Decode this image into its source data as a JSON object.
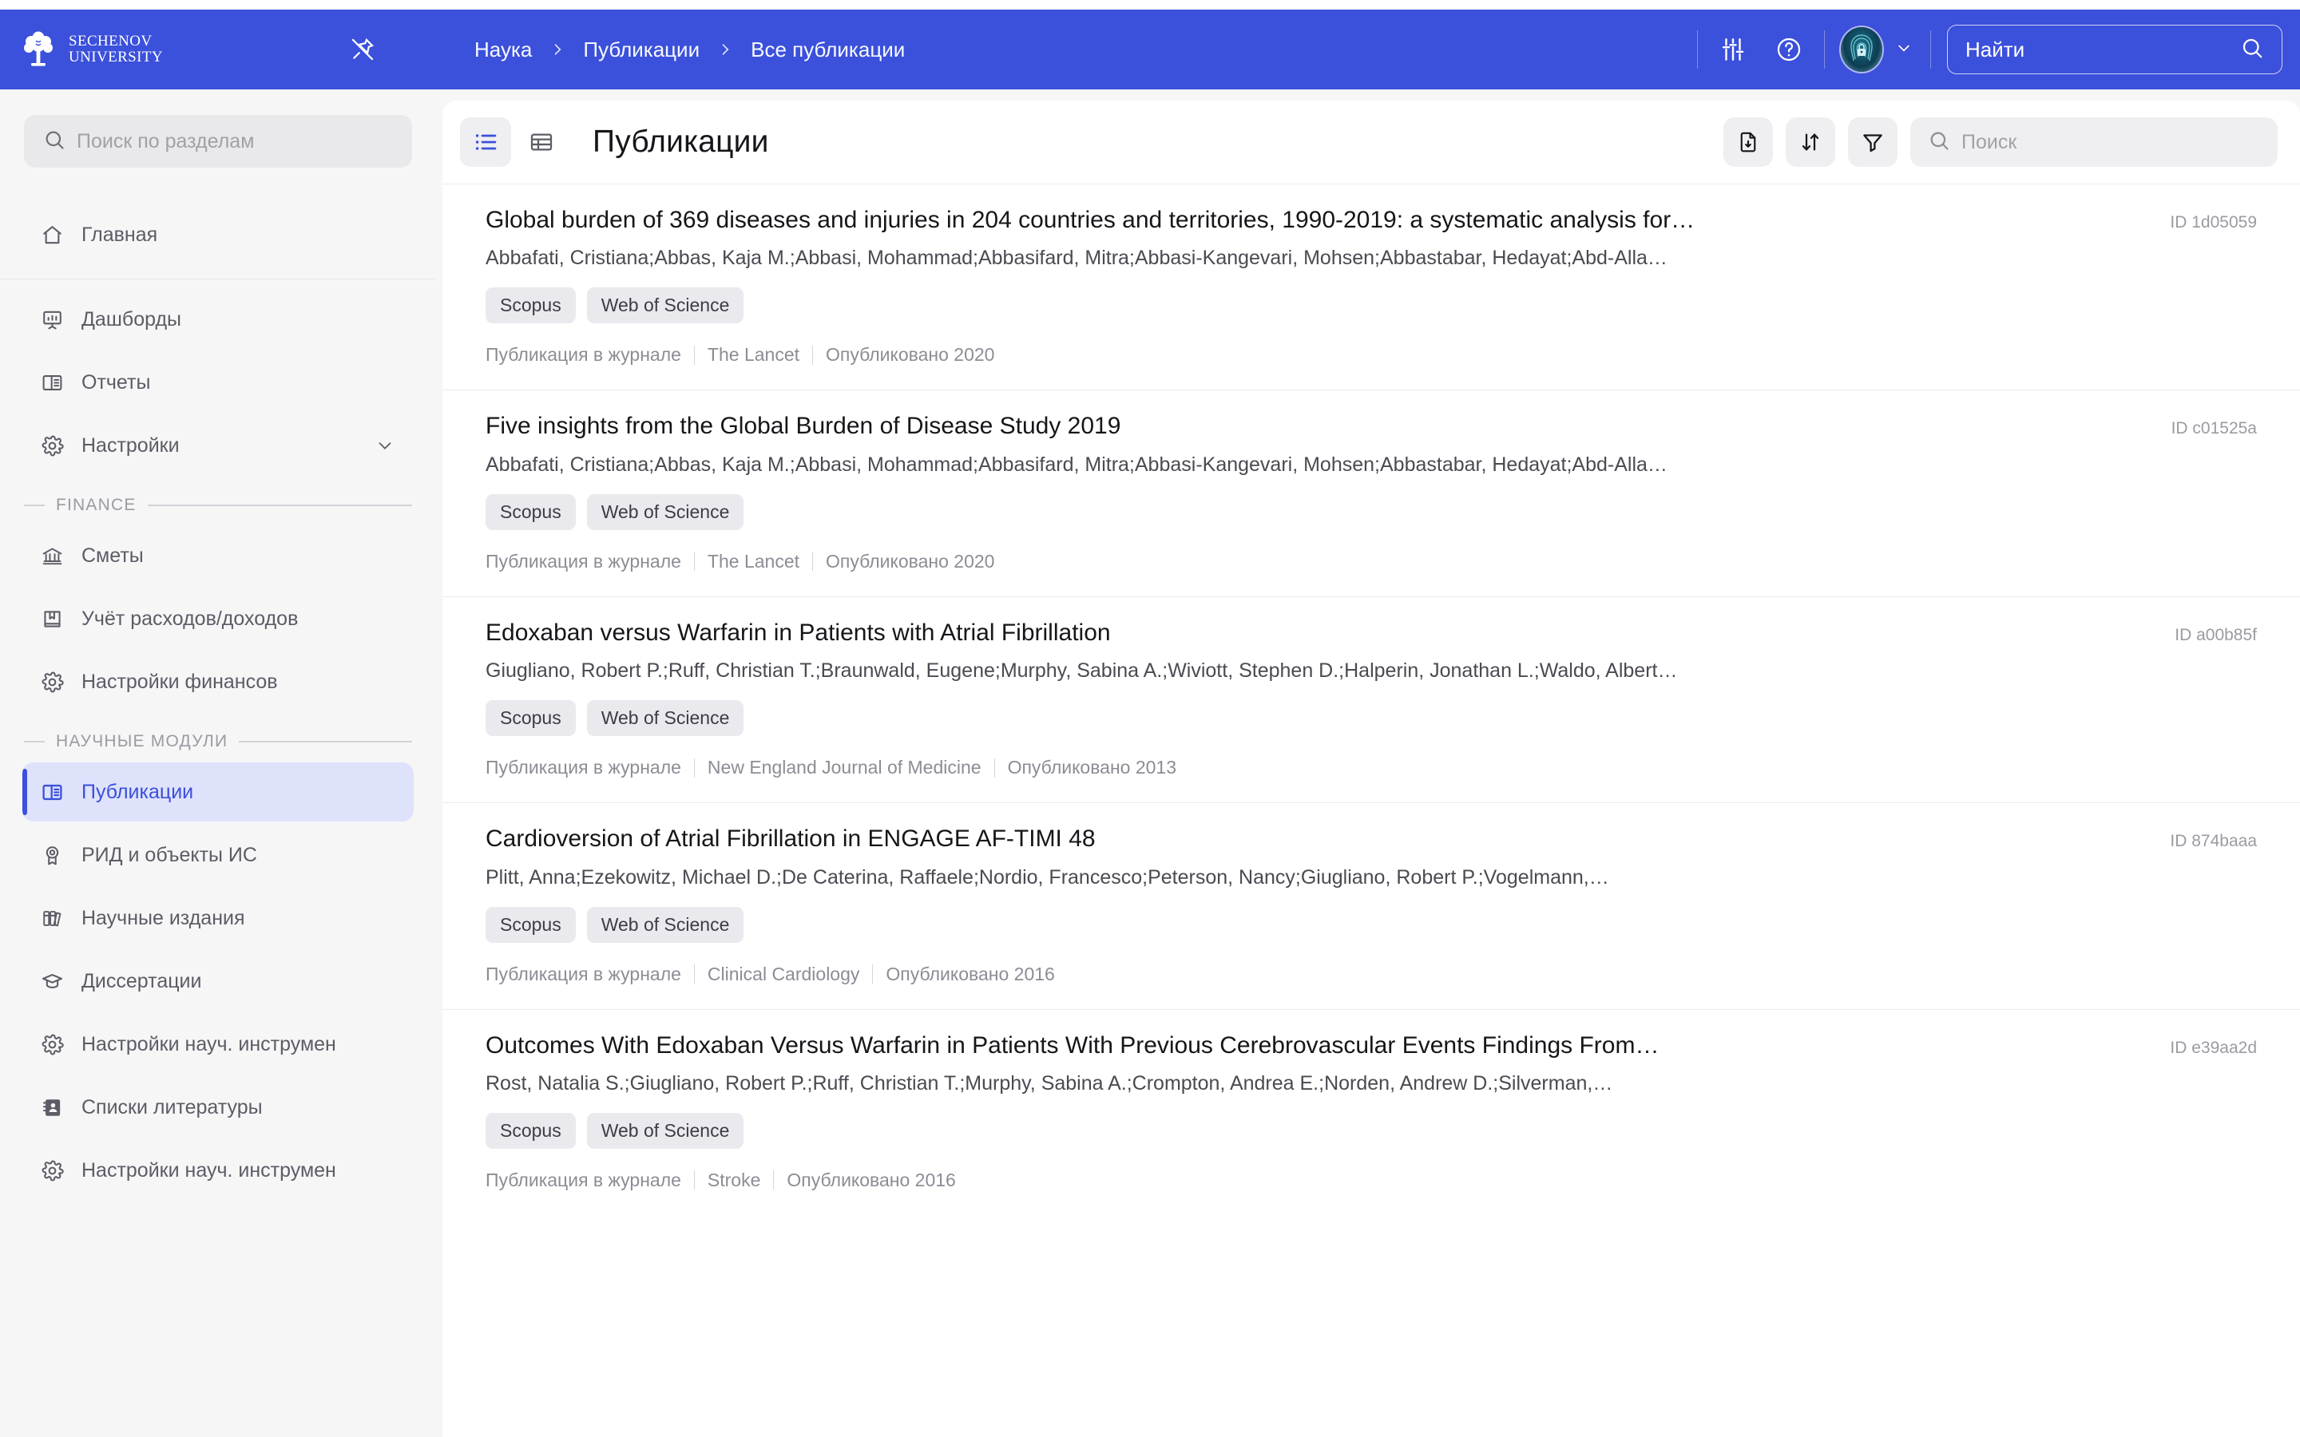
{
  "header": {
    "logo": {
      "line1": "SECHENOV",
      "line2": "UNIVERSITY",
      "icon": "tree-logo-icon"
    },
    "pin_icon": "pin-off-icon",
    "breadcrumb": [
      "Наука",
      "Публикации",
      "Все публикации"
    ],
    "tools": [
      {
        "name": "sliders-icon",
        "label": "Настройки отображения"
      },
      {
        "name": "help-circle-icon",
        "label": "Помощь"
      }
    ],
    "avatar": {
      "name": "user-avatar",
      "icon": "fingerprint-lock-icon"
    },
    "chevron_icon": "chevron-down-icon",
    "search": {
      "placeholder": "Найти",
      "value": "",
      "icon": "search-icon"
    }
  },
  "sidebar": {
    "search": {
      "placeholder": "Поиск по разделам",
      "value": "",
      "icon": "search-icon"
    },
    "items_top": [
      {
        "label": "Главная",
        "icon": "home-icon",
        "active": false
      },
      {
        "label": "Дашборды",
        "icon": "presentation-chart-icon",
        "active": false
      },
      {
        "label": "Отчеты",
        "icon": "book-open-icon",
        "active": false
      },
      {
        "label": "Настройки",
        "icon": "gear-icon",
        "active": false,
        "expandable": true
      }
    ],
    "group_finance": "FINANCE",
    "items_finance": [
      {
        "label": "Сметы",
        "icon": "bank-icon",
        "active": false
      },
      {
        "label": "Учёт расходов/доходов",
        "icon": "book-bookmark-icon",
        "active": false
      },
      {
        "label": "Настройки финансов",
        "icon": "gear-icon",
        "active": false
      }
    ],
    "group_science": "НАУЧНЫЕ МОДУЛИ",
    "items_science": [
      {
        "label": "Публикации",
        "icon": "book-open-icon",
        "active": true
      },
      {
        "label": "РИД и объекты ИС",
        "icon": "award-icon",
        "active": false
      },
      {
        "label": "Научные издания",
        "icon": "books-icon",
        "active": false
      },
      {
        "label": "Диссертации",
        "icon": "graduation-cap-icon",
        "active": false
      },
      {
        "label": "Настройки науч. инструмен",
        "icon": "gear-icon",
        "active": false
      },
      {
        "label": "Списки литературы",
        "icon": "contact-book-icon",
        "active": false
      },
      {
        "label": "Настройки науч. инструмен",
        "icon": "gear-icon",
        "active": false
      }
    ]
  },
  "main": {
    "title": "Публикации",
    "view_toggle": [
      {
        "name": "list-view-icon",
        "active": true
      },
      {
        "name": "table-view-icon",
        "active": false
      }
    ],
    "tools": [
      {
        "name": "export-file-icon"
      },
      {
        "name": "sort-icon"
      },
      {
        "name": "filter-icon"
      }
    ],
    "search": {
      "placeholder": "Поиск",
      "value": "",
      "icon": "search-icon"
    },
    "publications": [
      {
        "title": "Global burden of 369 diseases and injuries in 204 countries and territories, 1990-2019: a systematic analysis for…",
        "authors": "Abbafati, Cristiana;Abbas, Kaja M.;Abbasi, Mohammad;Abbasifard, Mitra;Abbasi-Kangevari, Mohsen;Abbastabar, Hedayat;Abd-Alla…",
        "id": "ID 1d05059",
        "tags": [
          "Scopus",
          "Web of Science"
        ],
        "type": "Публикация в журнале",
        "journal": "The Lancet",
        "published": "Опубликовано 2020"
      },
      {
        "title": "Five insights from the Global Burden of Disease Study 2019",
        "authors": "Abbafati, Cristiana;Abbas, Kaja M.;Abbasi, Mohammad;Abbasifard, Mitra;Abbasi-Kangevari, Mohsen;Abbastabar, Hedayat;Abd-Alla…",
        "id": "ID c01525a",
        "tags": [
          "Scopus",
          "Web of Science"
        ],
        "type": "Публикация в журнале",
        "journal": "The Lancet",
        "published": "Опубликовано 2020"
      },
      {
        "title": "Edoxaban versus Warfarin in Patients with Atrial Fibrillation",
        "authors": "Giugliano, Robert P.;Ruff, Christian T.;Braunwald, Eugene;Murphy, Sabina A.;Wiviott, Stephen D.;Halperin, Jonathan L.;Waldo, Albert…",
        "id": "ID a00b85f",
        "tags": [
          "Scopus",
          "Web of Science"
        ],
        "type": "Публикация в журнале",
        "journal": "New England Journal of Medicine",
        "published": "Опубликовано 2013"
      },
      {
        "title": "Cardioversion of Atrial Fibrillation in ENGAGE AF-TIMI 48",
        "authors": "Plitt, Anna;Ezekowitz, Michael D.;De Caterina, Raffaele;Nordio, Francesco;Peterson, Nancy;Giugliano, Robert P.;Vogelmann,…",
        "id": "ID 874baaa",
        "tags": [
          "Scopus",
          "Web of Science"
        ],
        "type": "Публикация в журнале",
        "journal": "Clinical Cardiology",
        "published": "Опубликовано 2016"
      },
      {
        "title": "Outcomes With Edoxaban Versus Warfarin in Patients With Previous Cerebrovascular Events Findings From…",
        "authors": "Rost, Natalia S.;Giugliano, Robert P.;Ruff, Christian T.;Murphy, Sabina A.;Crompton, Andrea E.;Norden, Andrew D.;Silverman,…",
        "id": "ID e39aa2d",
        "tags": [
          "Scopus",
          "Web of Science"
        ],
        "type": "Публикация в журнале",
        "journal": "Stroke",
        "published": "Опубликовано 2016"
      }
    ]
  },
  "colors": {
    "brand": "#3B50DB",
    "accent_bg": "#DFE2FB",
    "sidebar_bg": "#F6F6F7",
    "tag_bg": "#EAEAEE"
  }
}
